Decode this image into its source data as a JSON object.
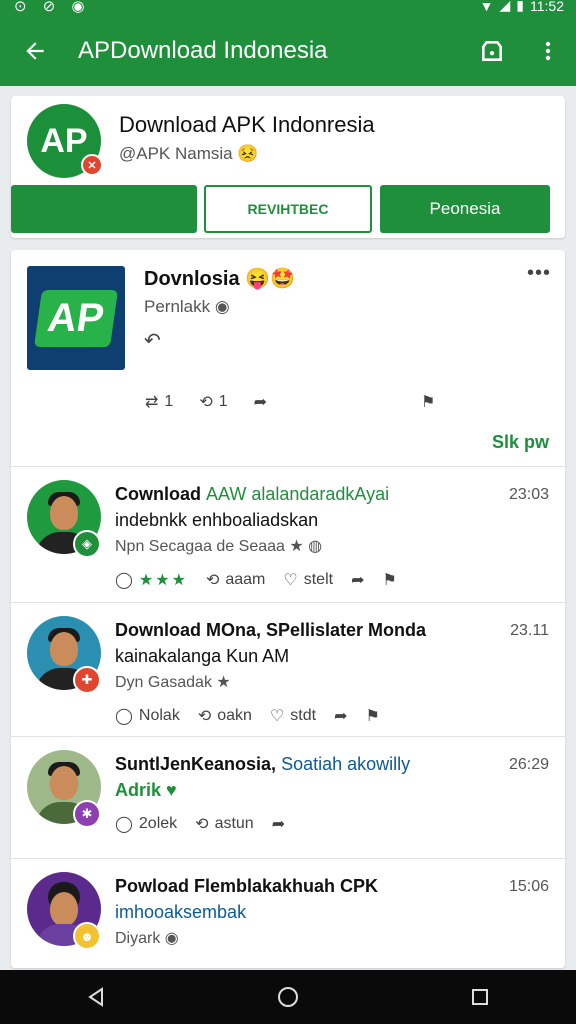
{
  "status": {
    "time": "11:52"
  },
  "appbar": {
    "title": "APDownload Indonesia"
  },
  "profile": {
    "logo_text": "AP",
    "name": "Download APK Indonresia",
    "handle": "@APK Namsia",
    "emoji": "😣",
    "btn_outline": "REVIHTBEC",
    "btn_green": "Peonesia"
  },
  "post": {
    "title": "Dovnlosia",
    "emojis": "😝🤩",
    "subtitle": "Pernlakk",
    "likes": "1",
    "reposts": "1",
    "show_more": "Slk pw",
    "icon_text": "AP"
  },
  "items": [
    {
      "title": "Cownload",
      "title_hl": "AAW alalandaradkAyai",
      "line2": "indebnkk enhboaliadskan",
      "meta": "Npn Secagaa de Seaaa ★",
      "time": "23:03",
      "c1": "",
      "c2": "aaam",
      "c3": "stelt"
    },
    {
      "title": "Download MOna, SPellislater Monda",
      "line2": "kainakalanga Kun AM",
      "meta": "Dyn Gasadak ★",
      "time": "23.11",
      "c1": "Nolak",
      "c2": "oakn",
      "c3": "stdt"
    },
    {
      "title": "SuntlJenKeanosia,",
      "title_hl": "Soatiah akowilly",
      "line2": "Adrik",
      "time": "26:29",
      "c1": "2olek",
      "c2": "astun"
    },
    {
      "title": "Powload Flemblakakhuah CPK",
      "line2": "imhooaksembak",
      "meta": "Diyark",
      "time": "15:06"
    }
  ]
}
